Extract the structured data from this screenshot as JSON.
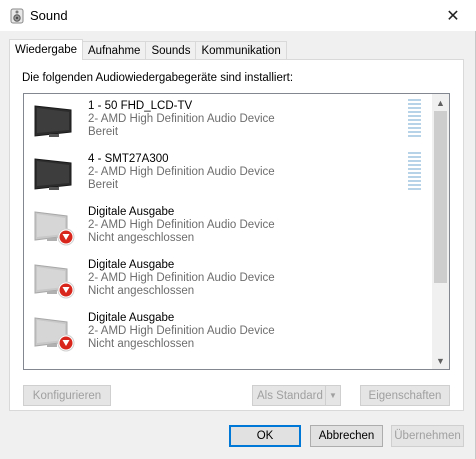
{
  "window": {
    "title": "Sound",
    "close_glyph": "✕"
  },
  "tabs": [
    {
      "label": "Wiedergabe",
      "active": true
    },
    {
      "label": "Aufnahme",
      "active": false
    },
    {
      "label": "Sounds",
      "active": false
    },
    {
      "label": "Kommunikation",
      "active": false
    }
  ],
  "panel": {
    "intro": "Die folgenden Audiowiedergabegeräte sind installiert:"
  },
  "devices": [
    {
      "name": "1 - 50 FHD_LCD-TV",
      "driver": "2- AMD High Definition Audio Device",
      "status": "Bereit",
      "icon": "monitor-icon",
      "connected": true
    },
    {
      "name": "4 - SMT27A300",
      "driver": "2- AMD High Definition Audio Device",
      "status": "Bereit",
      "icon": "monitor-icon",
      "connected": true
    },
    {
      "name": "Digitale Ausgabe",
      "driver": "2- AMD High Definition Audio Device",
      "status": "Nicht angeschlossen",
      "icon": "monitor-disconnected-icon",
      "connected": false
    },
    {
      "name": "Digitale Ausgabe",
      "driver": "2- AMD High Definition Audio Device",
      "status": "Nicht angeschlossen",
      "icon": "monitor-disconnected-icon",
      "connected": false
    },
    {
      "name": "Digitale Ausgabe",
      "driver": "2- AMD High Definition Audio Device",
      "status": "Nicht angeschlossen",
      "icon": "monitor-disconnected-icon",
      "connected": false
    }
  ],
  "buttons": {
    "configure": "Konfigurieren",
    "set_default": "Als Standard",
    "properties": "Eigenschaften",
    "ok": "OK",
    "cancel": "Abbrechen",
    "apply": "Übernehmen"
  },
  "colors": {
    "accent": "#0078d7",
    "meter": "#b6d3e7",
    "disconnected_badge": "#d9261c"
  }
}
